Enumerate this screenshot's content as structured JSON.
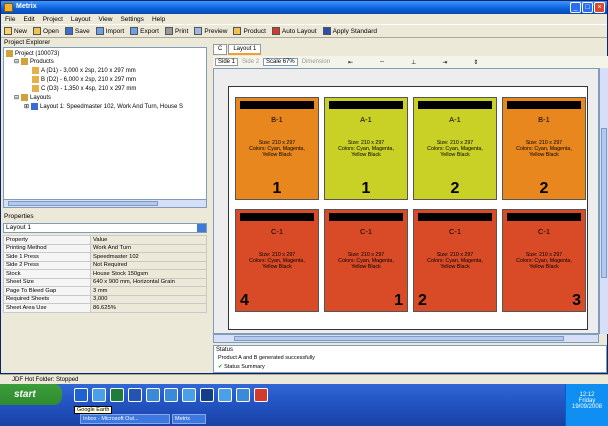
{
  "window": {
    "title": "Metrix"
  },
  "menu": [
    "File",
    "Edit",
    "Project",
    "Layout",
    "View",
    "Settings",
    "Help"
  ],
  "toolbar": [
    "New",
    "Open",
    "Save",
    "Import",
    "Export",
    "Print",
    "Preview",
    "Product",
    "Auto Layout",
    "Apply Standard"
  ],
  "explorer": {
    "title": "Project Explorer",
    "project": "Project (100073)",
    "products_label": "Products",
    "products": [
      "A (D1) - 3,000 x 2sp, 210 x 297 mm",
      "B (D2) - 6,000 x 2sp, 210 x 297 mm",
      "C (D3) - 1,350 x 4sp, 210 x 297 mm"
    ],
    "layouts_label": "Layouts",
    "layout_item": "Layout 1: Speedmaster 102, Work And Turn, House S"
  },
  "properties": {
    "title": "Properties",
    "selected": "Layout 1",
    "header": [
      "Property",
      "Value"
    ],
    "rows": [
      [
        "Printing Method",
        "Work And Turn"
      ],
      [
        "Side 1 Press",
        "Speedmaster 102"
      ],
      [
        "Side 2 Press",
        "Not Required"
      ],
      [
        "Stock",
        "House Stock 150gsm"
      ],
      [
        "Sheet Size",
        "640 x 900 mm, Horizontal Grain"
      ],
      [
        "Page To Bleed Gap",
        "3 mm"
      ],
      [
        "Required Sheets",
        "3,000"
      ],
      [
        "Sheet Area Use",
        "86.625%"
      ]
    ]
  },
  "doc_tabs": [
    "C",
    "Layout 1"
  ],
  "layout_controls": {
    "side1": "Side 1",
    "side2": "Side 2",
    "scale": "Scale 67%",
    "dimension": "Dimension"
  },
  "tiles": [
    {
      "name": "B-1",
      "desc": "Size: 210 x 297\nColors: Cyan, Magenta,\nYellow Black",
      "num": "1",
      "color": "#e8871e"
    },
    {
      "name": "A-1",
      "desc": "Size: 210 x 297\nColors: Cyan, Magenta,\nYellow Black",
      "num": "1",
      "color": "#c9d026"
    },
    {
      "name": "A-1",
      "desc": "Size: 210 x 297\nColors: Cyan, Magenta,\nYellow Black",
      "num": "2",
      "color": "#c9d026"
    },
    {
      "name": "B-1",
      "desc": "Size: 210 x 297\nColors: Cyan, Magenta,\nYellow Black",
      "num": "2",
      "color": "#e8871e"
    },
    {
      "name": "C-1",
      "desc": "Size: 210 x 297\nColors: Cyan, Magenta,\nYellow Black",
      "num": "4",
      "color": "#d94b27"
    },
    {
      "name": "C-1",
      "desc": "Size: 210 x 297\nColors: Cyan, Magenta,\nYellow Black",
      "num": "1",
      "color": "#d94b27"
    },
    {
      "name": "C-1",
      "desc": "Size: 210 x 297\nColors: Cyan, Magenta,\nYellow Black",
      "num": "2",
      "color": "#d94b27"
    },
    {
      "name": "C-1",
      "desc": "Size: 210 x 297\nColors: Cyan, Magenta,\nYellow Black",
      "num": "3",
      "color": "#d94b27"
    }
  ],
  "status": {
    "title": "Status",
    "line1": "Product A and B generated successfully",
    "line2": "Status Summary"
  },
  "notification": "JDF Hot Folder: Stopped",
  "taskbar": {
    "start": "start",
    "tooltip": "Google Earth",
    "items": [
      "Inbox - Microsoft Out...",
      "Metrix"
    ],
    "time": "12:12",
    "day": "Friday",
    "date": "19/09/2008"
  }
}
